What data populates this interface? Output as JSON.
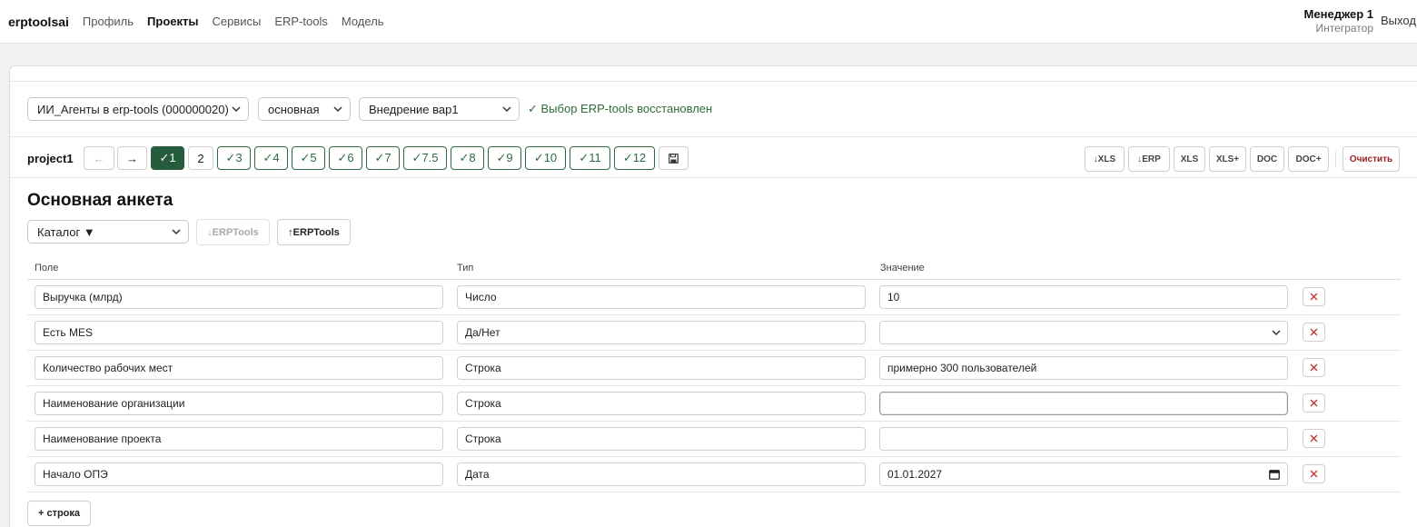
{
  "nav": {
    "brand": "erptoolsai",
    "links": [
      "Профиль",
      "Проекты",
      "Сервисы",
      "ERP-tools",
      "Модель"
    ],
    "user_name": "Менеджер 1",
    "user_role": "Интегратор",
    "logout": "Выход"
  },
  "selectors": {
    "project": "ИИ_Агенты в erp-tools (000000020)",
    "branch": "основная",
    "variant": "Внедрение вар1",
    "status": "✓ Выбор ERP-tools восстановлен"
  },
  "versions": {
    "project_name": "project1",
    "prev": "←",
    "next": "→",
    "items": [
      "✓1",
      "2",
      "✓3",
      "✓4",
      "✓5",
      "✓6",
      "✓7",
      "✓7.5",
      "✓8",
      "✓9",
      "✓10",
      "✓11",
      "✓12"
    ],
    "save_icon": "save-icon"
  },
  "exports": [
    "↓XLS",
    "↓ERP",
    "XLS",
    "XLS+",
    "DOC",
    "DOC+"
  ],
  "clear": "Очистить",
  "section": {
    "title": "Основная анкета",
    "catalog": "Каталог ▼",
    "download": "↓ERPTools",
    "upload": "↑ERPTools"
  },
  "table": {
    "headers": [
      "Поле",
      "Тип",
      "Значение"
    ],
    "rows": [
      {
        "field": "Выручка (млрд)",
        "type": "Число",
        "value": "10",
        "kind": "text"
      },
      {
        "field": "Есть MES",
        "type": "Да/Нет",
        "value": "",
        "kind": "select"
      },
      {
        "field": "Количество рабочих мест",
        "type": "Строка",
        "value": "примерно 300 пользователей",
        "kind": "text"
      },
      {
        "field": "Наименование организации",
        "type": "Строка",
        "value": "",
        "kind": "text"
      },
      {
        "field": "Наименование проекта",
        "type": "Строка",
        "value": "",
        "kind": "text"
      },
      {
        "field": "Начало ОПЭ",
        "type": "Дата",
        "value": "01.01.2027",
        "kind": "date"
      }
    ],
    "add_row": "+ строка"
  },
  "colors": {
    "accent_green": "#265c3e",
    "status_green": "#2f6b3c",
    "danger_red": "#9b2323"
  }
}
